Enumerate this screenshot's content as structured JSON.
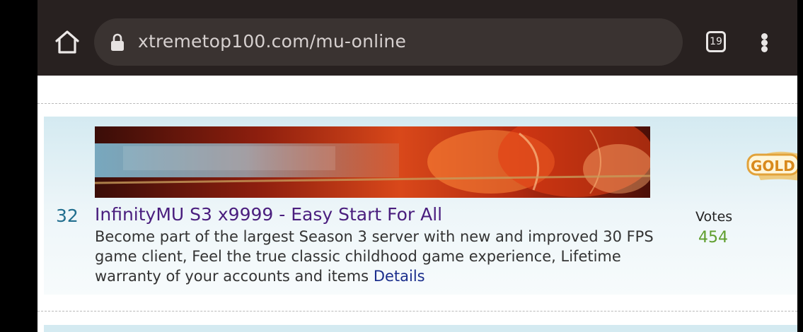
{
  "browser": {
    "url": "xtremetop100.com/mu-online",
    "tab_count": "19"
  },
  "listing": {
    "rank": "32",
    "title": "InfinityMU S3 x9999 - Easy Start For All",
    "description": "Become part of the largest Season 3 server with new and improved 30 FPS game client, Feel the true classic childhood game experience, Lifetime warranty of your accounts and items",
    "details_label": "Details",
    "votes_label": "Votes",
    "votes_count": "454",
    "badge_text": "GOLD"
  },
  "colors": {
    "toolbar_bg": "#282120",
    "url_bar_bg": "#3a3331",
    "title_color": "#4a1e7e",
    "votes_color": "#5f9e2d",
    "details_color": "#1b2e8c"
  }
}
